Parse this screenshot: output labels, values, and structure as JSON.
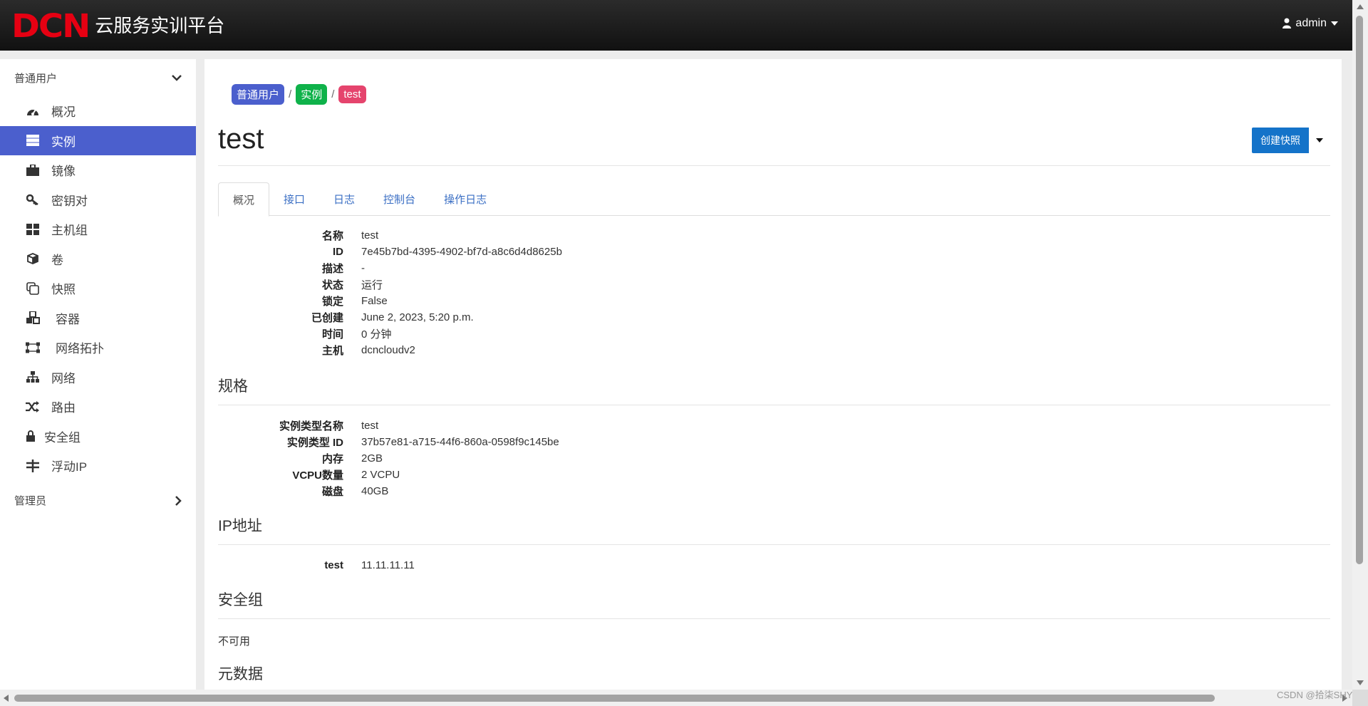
{
  "header": {
    "logo_mark": "DCN",
    "logo_text": "云服务实训平台",
    "user": "admin"
  },
  "sidebar": {
    "group_user": "普通用户",
    "group_admin": "管理员",
    "items": [
      {
        "label": "概况",
        "icon": "dashboard-icon"
      },
      {
        "label": "实例",
        "icon": "server-icon"
      },
      {
        "label": "镜像",
        "icon": "briefcase-icon"
      },
      {
        "label": "密钥对",
        "icon": "key-icon"
      },
      {
        "label": "主机组",
        "icon": "grid-icon"
      },
      {
        "label": "卷",
        "icon": "cube-icon"
      },
      {
        "label": "快照",
        "icon": "copy-icon"
      },
      {
        "label": "容器",
        "icon": "cubes-icon"
      },
      {
        "label": "网络拓扑",
        "icon": "topology-icon"
      },
      {
        "label": "网络",
        "icon": "sitemap-icon"
      },
      {
        "label": "路由",
        "icon": "random-icon"
      },
      {
        "label": "安全组",
        "icon": "lock-icon"
      },
      {
        "label": "浮动IP",
        "icon": "float-ip-icon"
      }
    ]
  },
  "breadcrumb": [
    "普通用户",
    "实例",
    "test"
  ],
  "page": {
    "title": "test",
    "snapshot_button": "创建快照"
  },
  "tabs": [
    "概况",
    "接口",
    "日志",
    "控制台",
    "操作日志"
  ],
  "overview": [
    {
      "key": "名称",
      "value": "test"
    },
    {
      "key": "ID",
      "value": "7e45b7bd-4395-4902-bf7d-a8c6d4d8625b"
    },
    {
      "key": "描述",
      "value": "-"
    },
    {
      "key": "状态",
      "value": "运行"
    },
    {
      "key": "锁定",
      "value": "False"
    },
    {
      "key": "已创建",
      "value": "June 2, 2023, 5:20 p.m."
    },
    {
      "key": "时间",
      "value": "0 分钟"
    },
    {
      "key": "主机",
      "value": "dcncloudv2"
    }
  ],
  "spec": {
    "heading": "规格",
    "rows": [
      {
        "key": "实例类型名称",
        "value": "test"
      },
      {
        "key": "实例类型 ID",
        "value": "37b57e81-a715-44f6-860a-0598f9c145be"
      },
      {
        "key": "内存",
        "value": "2GB"
      },
      {
        "key": "VCPU数量",
        "value": "2 VCPU"
      },
      {
        "key": "磁盘",
        "value": "40GB"
      }
    ]
  },
  "ip": {
    "heading": "IP地址",
    "rows": [
      {
        "key": "test",
        "value": "11.11.11.11"
      }
    ]
  },
  "security": {
    "heading": "安全组",
    "text": "不可用"
  },
  "metadata": {
    "heading": "元数据"
  },
  "watermark": "CSDN @拾柒SHY",
  "colors": {
    "accent": "#4b5fcd",
    "green": "#0fb24a",
    "red": "#e5446d",
    "button": "#1473c9",
    "logo": "#e60012"
  }
}
